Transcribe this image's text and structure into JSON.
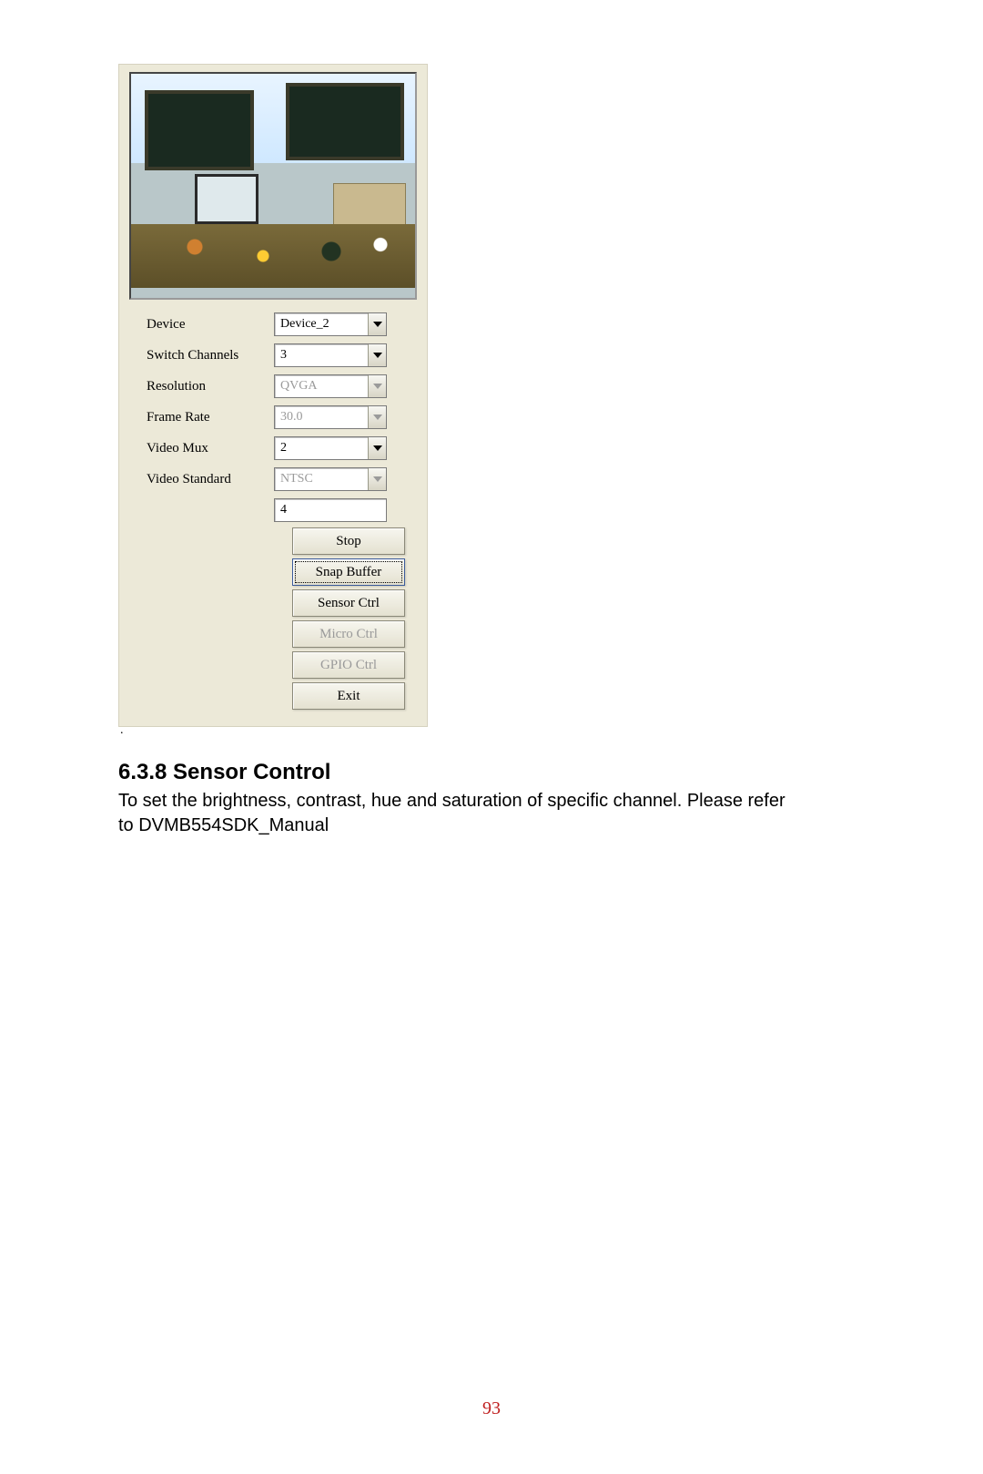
{
  "form": {
    "device": {
      "label": "Device",
      "value": "Device_2",
      "enabled": true
    },
    "switch_channels": {
      "label": "Switch Channels",
      "value": "3",
      "enabled": true
    },
    "resolution": {
      "label": "Resolution",
      "value": "QVGA",
      "enabled": false
    },
    "frame_rate": {
      "label": "Frame Rate",
      "value": "30.0",
      "enabled": false
    },
    "video_mux": {
      "label": "Video Mux",
      "value": "2",
      "enabled": true
    },
    "video_standard": {
      "label": "Video Standard",
      "value": "NTSC",
      "enabled": false
    },
    "text_field": {
      "value": "4"
    }
  },
  "buttons": {
    "stop": "Stop",
    "snap_buffer": "Snap Buffer",
    "sensor_ctrl": "Sensor Ctrl",
    "micro_ctrl": "Micro Ctrl",
    "gpio_ctrl": "GPIO Ctrl",
    "exit": "Exit"
  },
  "section": {
    "number_title": "6.3.8 Sensor Control",
    "body": "To set the brightness, contrast, hue and saturation of specific channel. Please refer to DVMB554SDK_Manual"
  },
  "page_number": "93"
}
